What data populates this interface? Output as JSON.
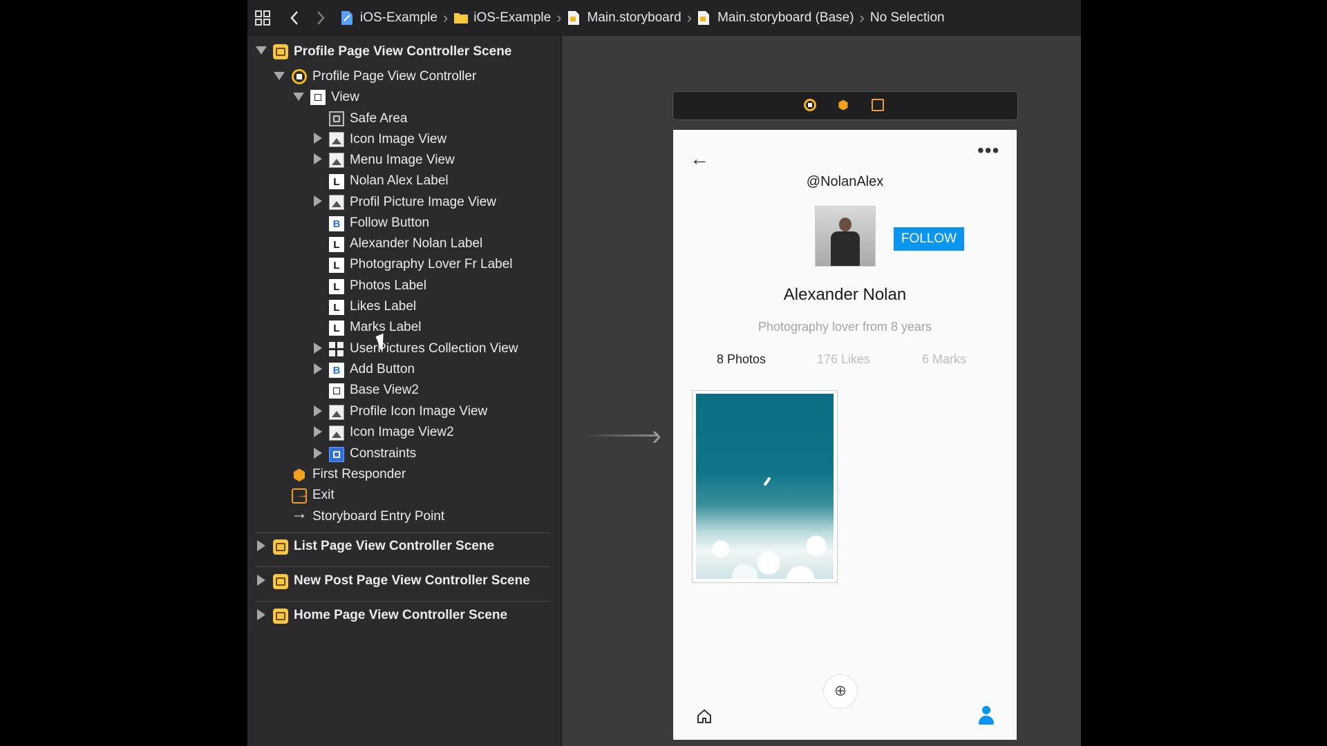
{
  "breadcrumb": {
    "items": [
      "iOS-Example",
      "iOS-Example",
      "Main.storyboard",
      "Main.storyboard (Base)",
      "No Selection"
    ]
  },
  "outline": {
    "profile_scene": "Profile Page View Controller Scene",
    "view_controller": "Profile Page View Controller",
    "view": "View",
    "children": [
      {
        "label": "Safe Area",
        "icon": "safe-area-icon"
      },
      {
        "label": "Icon Image View",
        "icon": "image-view-icon"
      },
      {
        "label": "Menu Image View",
        "icon": "image-view-icon"
      },
      {
        "label": "Nolan Alex Label",
        "icon": "label-icon"
      },
      {
        "label": "Profil Picture Image View",
        "icon": "image-view-icon"
      },
      {
        "label": "Follow Button",
        "icon": "button-icon"
      },
      {
        "label": "Alexander Nolan Label",
        "icon": "label-icon"
      },
      {
        "label": "Photography Lover Fr Label",
        "icon": "label-icon"
      },
      {
        "label": "Photos Label",
        "icon": "label-icon"
      },
      {
        "label": "Likes Label",
        "icon": "label-icon"
      },
      {
        "label": "Marks Label",
        "icon": "label-icon"
      },
      {
        "label": "UserPictures Collection View",
        "icon": "collection-view-icon"
      },
      {
        "label": "Add Button",
        "icon": "button-icon"
      },
      {
        "label": "Base View2",
        "icon": "view-icon"
      },
      {
        "label": "Profile Icon Image View",
        "icon": "image-view-icon"
      },
      {
        "label": "Icon Image View2",
        "icon": "image-view-icon"
      },
      {
        "label": "Constraints",
        "icon": "constraints-icon"
      }
    ],
    "first_responder": "First Responder",
    "exit": "Exit",
    "entry_point": "Storyboard Entry Point",
    "other_scenes": [
      "List Page View Controller Scene",
      "New Post Page View Controller Scene",
      "Home Page View Controller Scene"
    ]
  },
  "phone": {
    "handle": "@NolanAlex",
    "follow": "FOLLOW",
    "name": "Alexander Nolan",
    "bio": "Photography lover from 8 years",
    "stats": [
      "8 Photos",
      "176 Likes",
      "6 Marks"
    ],
    "accent": "#0a95f0"
  },
  "colors": {
    "sidebar_bg": "#2b2b2d",
    "canvas_bg": "#3b3b3d",
    "scene_icon": "#f7c744"
  }
}
